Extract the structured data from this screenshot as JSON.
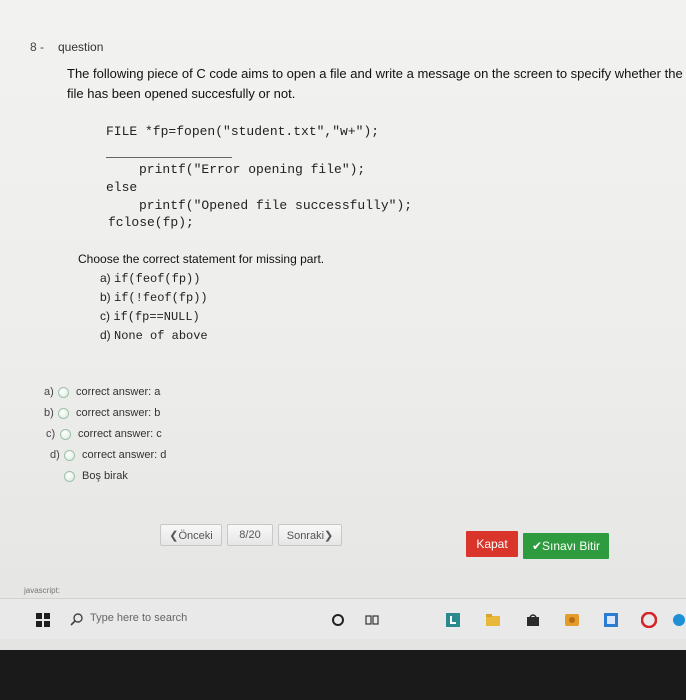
{
  "question": {
    "number": "8 -",
    "label": "question",
    "text": "The following piece of C code aims to open a file and write a message on the screen to specify whether the file has been opened succesfully or not."
  },
  "code": {
    "line1": "FILE *fp=fopen(\"student.txt\",\"w+\");",
    "line2": "printf(\"Error opening file\");",
    "line3": "else",
    "line4": "printf(\"Opened file successfully\");",
    "line5": "fclose(fp);"
  },
  "prompt": "Choose the correct statement for missing part.",
  "options": [
    {
      "letter": "a)",
      "code": "if(feof(fp))"
    },
    {
      "letter": "b)",
      "code": "if(!feof(fp))"
    },
    {
      "letter": "c)",
      "code": "if(fp==NULL)"
    },
    {
      "letter": "d)",
      "code": "None of above"
    }
  ],
  "answers": [
    {
      "letter": "a)",
      "label": "correct answer: a"
    },
    {
      "letter": "b)",
      "label": "correct answer: b"
    },
    {
      "letter": "c)",
      "label": "correct answer: c"
    },
    {
      "letter": "d)",
      "label": "correct answer: d"
    },
    {
      "letter": "",
      "label": "Boş birak"
    }
  ],
  "nav": {
    "prev": "❮Önceki",
    "page": "8/20",
    "next": "Sonraki❯",
    "close": "Kapat",
    "finish": "✔Sınavı Bitir"
  },
  "status_text": "javascript:",
  "taskbar": {
    "search_placeholder": "Type here to search"
  },
  "colors": {
    "close_button": "#d9352a",
    "finish_button": "#2e9b3e"
  }
}
